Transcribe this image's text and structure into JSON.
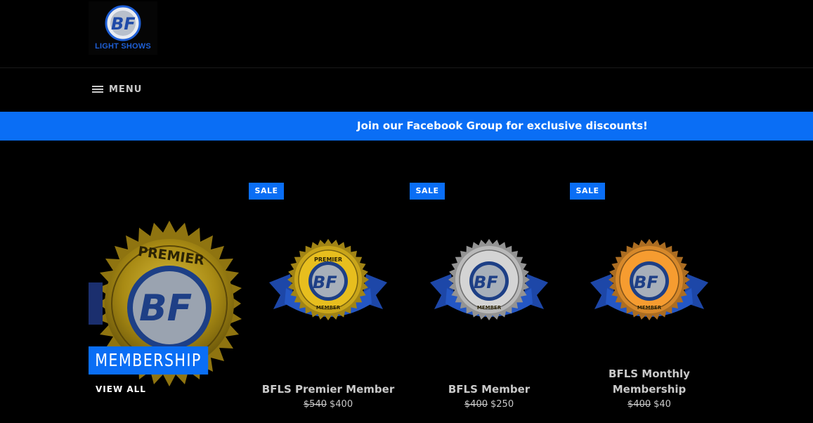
{
  "header": {
    "logo_text": "LIGHT SHOWS",
    "logo_letters": "BF",
    "menu_label": "MENU"
  },
  "announcement": {
    "text": "Join our Facebook Group for exclusive discounts!"
  },
  "collection": {
    "badge_text": "PREMIER",
    "title": "MEMBERSHIP",
    "view_all": "VIEW ALL"
  },
  "products": [
    {
      "sale_label": "SALE",
      "title": "BFLS Premier Member",
      "title_line2": "",
      "compare_price": "$540",
      "price": "$400",
      "badge_top_text": "PREMIER",
      "badge_bottom_text": "MEMBER",
      "badge_color": "#c9a51a"
    },
    {
      "sale_label": "SALE",
      "title": "BFLS Member",
      "title_line2": "",
      "compare_price": "$400",
      "price": "$250",
      "badge_top_text": "",
      "badge_bottom_text": "MEMBER",
      "badge_color": "#b8b8b8"
    },
    {
      "sale_label": "SALE",
      "title": "BFLS Monthly",
      "title_line2": "Membership",
      "compare_price": "$400",
      "price": "$40",
      "badge_top_text": "",
      "badge_bottom_text": "MEMBER",
      "badge_color": "#d6882a"
    }
  ],
  "colors": {
    "accent": "#0a6ef5",
    "background": "#000000",
    "text_muted": "#c9c9c9"
  }
}
